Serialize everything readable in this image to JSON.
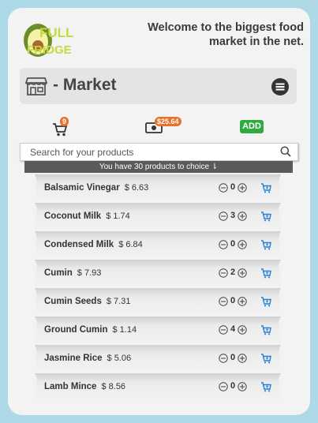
{
  "header": {
    "logo_line1": "FULL",
    "logo_line2": "FRIDGE",
    "welcome": "Welcome to the biggest food market in the net."
  },
  "market_bar": {
    "title": "- Market"
  },
  "stats": {
    "cart_count": "9",
    "money": "$25.64",
    "add_label": "ADD"
  },
  "search": {
    "placeholder": "Search for your products"
  },
  "info": {
    "text": "You have 30 products to choice ⇂"
  },
  "products": [
    {
      "name": "Balsamic Vinegar",
      "price": "$ 6.63",
      "qty": "0"
    },
    {
      "name": "Coconut Milk",
      "price": "$ 1.74",
      "qty": "3"
    },
    {
      "name": "Condensed Milk",
      "price": "$ 6.84",
      "qty": "0"
    },
    {
      "name": "Cumin",
      "price": "$ 7.93",
      "qty": "2"
    },
    {
      "name": "Cumin Seeds",
      "price": "$ 7.31",
      "qty": "0"
    },
    {
      "name": "Ground Cumin",
      "price": "$ 1.14",
      "qty": "4"
    },
    {
      "name": "Jasmine Rice",
      "price": "$ 5.06",
      "qty": "0"
    },
    {
      "name": "Lamb Mince",
      "price": "$ 8.56",
      "qty": "0"
    }
  ],
  "colors": {
    "background": "#add8e6",
    "accent_orange": "#e8712b",
    "add_green": "#2eaa3e",
    "cart_blue": "#1f7fd6"
  },
  "icons": {
    "logo": "avocado-logo-icon",
    "market": "storefront-icon",
    "menu": "hamburger-menu-icon",
    "cart": "shopping-cart-icon",
    "money": "money-bill-icon",
    "search": "magnifier-icon",
    "minus": "minus-circle-icon",
    "plus": "plus-circle-icon",
    "add_to_cart": "add-to-cart-icon"
  }
}
